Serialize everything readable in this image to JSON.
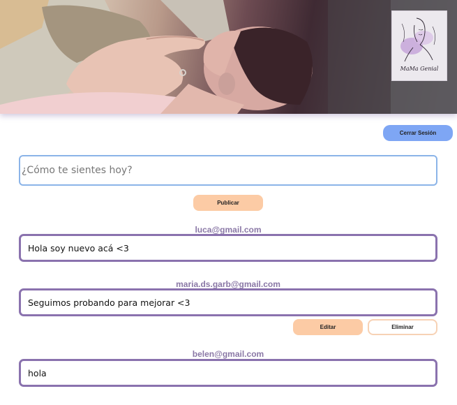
{
  "header": {
    "banner_icon": "mother-and-baby-photo",
    "logo_icon": "line-art-portrait-logo",
    "logo_text": "MaMa Genial"
  },
  "session": {
    "logout_label": "Cerrar Sesión"
  },
  "composer": {
    "placeholder": "¿Cómo te sientes hoy?",
    "value": "",
    "publish_label": "Publicar"
  },
  "posts": [
    {
      "author": "luca@gmail.com",
      "text": "Hola soy nuevo acá <3"
    },
    {
      "author": "maria.ds.garb@gmail.com",
      "text": "Seguimos probando para mejorar <3",
      "edit_label": "Editar",
      "delete_label": "Eliminar"
    },
    {
      "author": "belen@gmail.com",
      "text": "hola"
    }
  ],
  "colors": {
    "logout_button": "#7ea6f4",
    "action_button": "#fccba5",
    "post_border": "#8a72ae",
    "author_text": "#8a78a6",
    "input_border": "#8bb4e8"
  }
}
